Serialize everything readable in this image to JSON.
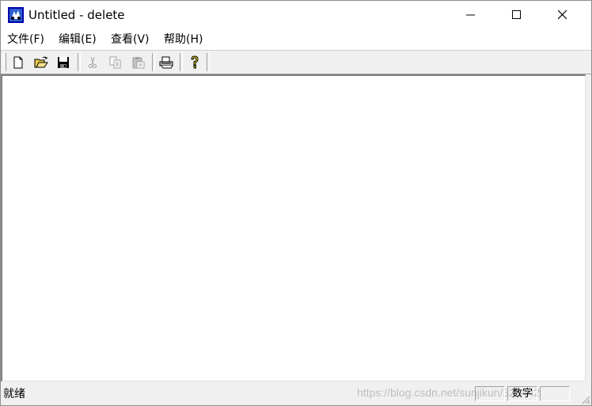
{
  "window": {
    "title": "Untitled - delete"
  },
  "icons": {
    "app": "mfc-app-icon",
    "minimize": "minimize-icon",
    "maximize": "maximize-icon",
    "close": "close-icon"
  },
  "menu": [
    {
      "label": "文件(F)"
    },
    {
      "label": "编辑(E)"
    },
    {
      "label": "查看(V)"
    },
    {
      "label": "帮助(H)"
    }
  ],
  "toolbar": [
    {
      "icon": "new-file-icon",
      "enabled": true
    },
    {
      "icon": "open-folder-icon",
      "enabled": true
    },
    {
      "icon": "save-disk-icon",
      "enabled": true
    },
    {
      "icon": "cut-scissors-icon",
      "enabled": false
    },
    {
      "icon": "copy-icon",
      "enabled": false
    },
    {
      "icon": "paste-icon",
      "enabled": false
    },
    {
      "icon": "print-icon",
      "enabled": true
    },
    {
      "icon": "help-question-icon",
      "enabled": true
    }
  ],
  "status": {
    "text": "就绪",
    "num_indicator": "数字",
    "watermark": "https://blog.csdn.net/sunjikun/326442"
  }
}
